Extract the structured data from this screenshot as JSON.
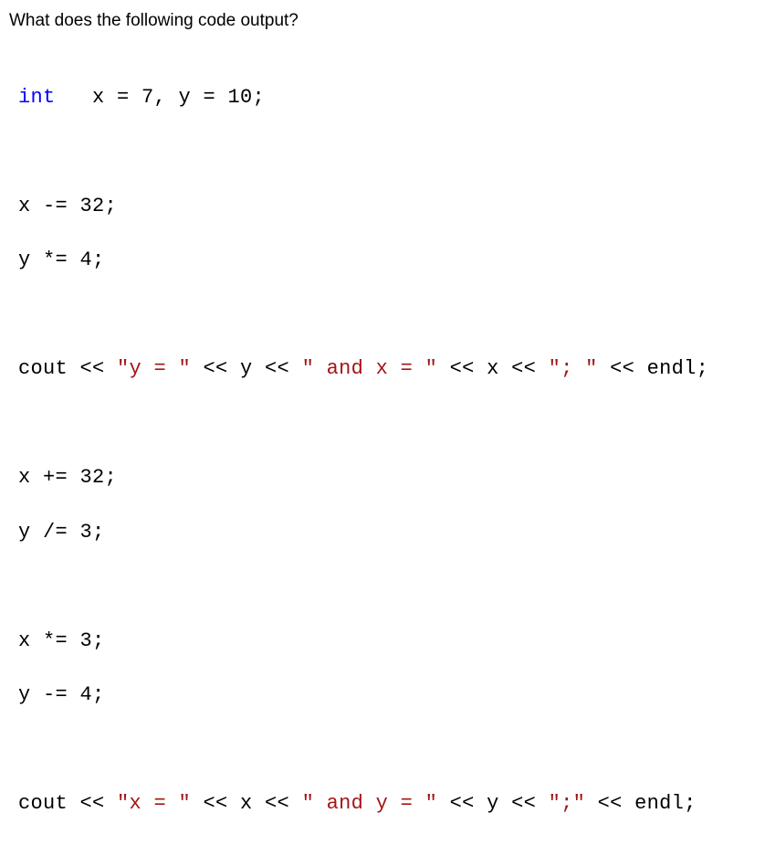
{
  "question": "What does the following code output?",
  "code": {
    "line1": {
      "keyword": "int",
      "rest": "   x = 7, y = 10;"
    },
    "line3": "x -= 32;",
    "line4": "y *= 4;",
    "line6": {
      "p1": "cout << ",
      "s1": "\"y = \"",
      "p2": " << y << ",
      "s2": "\" and x = \"",
      "p3": " << x << ",
      "s3": "\"; \"",
      "p4": " << endl;"
    },
    "line8": "x += 32;",
    "line9": "y /= 3;",
    "line11": "x *= 3;",
    "line12": "y -= 4;",
    "line14": {
      "p1": "cout << ",
      "s1": "\"x = \"",
      "p2": " << x << ",
      "s2": "\" and y = \"",
      "p3": " << y << ",
      "s3": "\";\"",
      "p4": " << endl;"
    }
  }
}
